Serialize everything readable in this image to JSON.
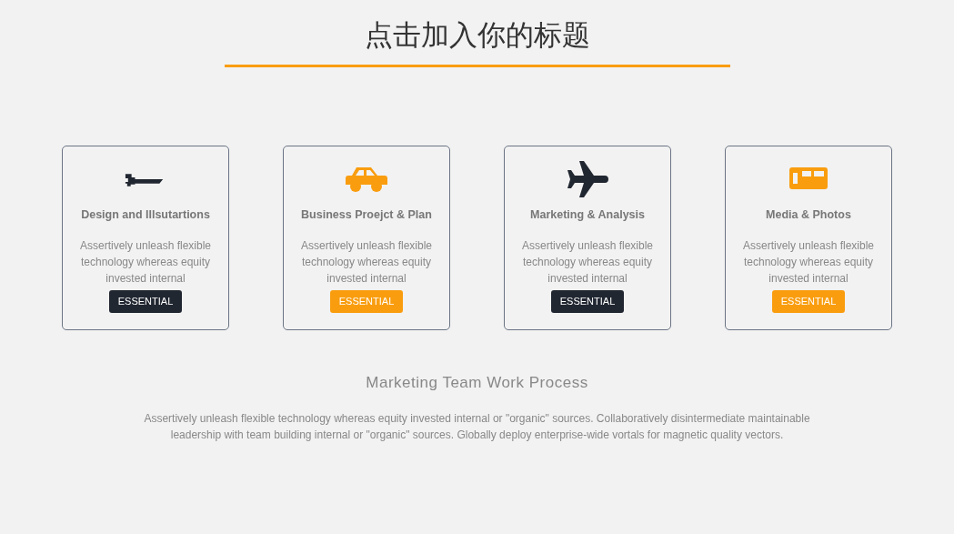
{
  "title": "点击加入你的标题",
  "cards": [
    {
      "heading": "Design and Illsutartions",
      "text": "Assertively unleash flexible technology whereas equity invested internal",
      "button": "ESSENTIAL",
      "color": "#212731"
    },
    {
      "heading": "Business Proejct & Plan",
      "text": "Assertively unleash flexible technology whereas equity invested internal",
      "button": "ESSENTIAL",
      "color": "#f99d0f"
    },
    {
      "heading": "Marketing & Analysis",
      "text": "Assertively unleash flexible technology whereas equity invested internal",
      "button": "ESSENTIAL",
      "color": "#212731"
    },
    {
      "heading": "Media & Photos",
      "text": "Assertively unleash flexible technology whereas equity invested internal",
      "button": "ESSENTIAL",
      "color": "#f99d0f"
    }
  ],
  "section": {
    "heading": "Marketing Team Work Process",
    "text": "Assertively unleash flexible technology whereas equity invested internal or \"organic\" sources. Collaboratively disintermediate maintainable leadership with team building internal or \"organic\" sources. Globally deploy enterprise-wide vortals for magnetic quality vectors."
  }
}
